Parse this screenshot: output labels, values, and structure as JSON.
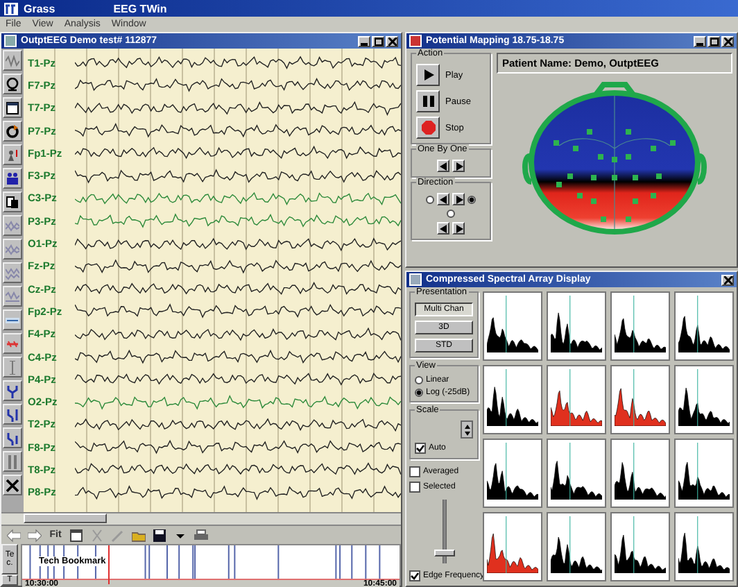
{
  "app_bar": {
    "title": "Grass",
    "subtitle": "EEG TWin"
  },
  "menu": [
    "File",
    "View",
    "Analysis",
    "Window"
  ],
  "eeg_window": {
    "title": "OutptEEG Demo test# 112877",
    "channels": [
      {
        "label": "T1-Pz",
        "highlighted": false
      },
      {
        "label": "F7-Pz",
        "highlighted": false
      },
      {
        "label": "T7-Pz",
        "highlighted": false
      },
      {
        "label": "P7-Pz",
        "highlighted": false
      },
      {
        "label": "Fp1-Pz",
        "highlighted": false
      },
      {
        "label": "F3-Pz",
        "highlighted": false
      },
      {
        "label": "C3-Pz",
        "highlighted": true
      },
      {
        "label": "P3-Pz",
        "highlighted": true
      },
      {
        "label": "O1-Pz",
        "highlighted": false
      },
      {
        "label": "Fz-Pz",
        "highlighted": false
      },
      {
        "label": "Cz-Pz",
        "highlighted": false
      },
      {
        "label": "Fp2-Pz",
        "highlighted": false
      },
      {
        "label": "F4-Pz",
        "highlighted": false
      },
      {
        "label": "C4-Pz",
        "highlighted": false
      },
      {
        "label": "P4-Pz",
        "highlighted": false
      },
      {
        "label": "O2-Pz",
        "highlighted": true
      },
      {
        "label": "T2-Pz",
        "highlighted": false
      },
      {
        "label": "F8-Pz",
        "highlighted": false
      },
      {
        "label": "T8-Pz",
        "highlighted": false
      },
      {
        "label": "P8-Pz",
        "highlighted": false
      }
    ],
    "toolbar": {
      "fit_label": "Fit"
    },
    "bookmarks": {
      "side_label": "Tec.",
      "side_button": "T",
      "label": "Tech Bookmark",
      "start_time": "10:30:00",
      "end_time": "10:45:00"
    }
  },
  "mapping_window": {
    "title": "Potential Mapping 18.75-18.75",
    "action_group": {
      "title": "Action",
      "play": "Play",
      "pause": "Pause",
      "stop": "Stop"
    },
    "one_by_one_group": {
      "title": "One By One"
    },
    "direction_group": {
      "title": "Direction",
      "options": [
        {
          "selected": false
        },
        {
          "selected": true
        },
        {
          "selected": false
        }
      ]
    },
    "patient_name": "Patient Name: Demo, OutptEEG"
  },
  "csa_window": {
    "title": "Compressed Spectral Array Display",
    "presentation": {
      "title": "Presentation",
      "buttons": [
        {
          "label": "Multi Chan",
          "selected": true
        },
        {
          "label": "3D",
          "selected": false
        },
        {
          "label": "STD",
          "selected": false
        }
      ]
    },
    "view": {
      "title": "View",
      "options": [
        {
          "label": "Linear",
          "selected": false
        },
        {
          "label": "Log (-25dB)",
          "selected": true
        }
      ]
    },
    "scale": {
      "title": "Scale",
      "auto_label": "Auto",
      "auto_checked": true
    },
    "averaged": {
      "label": "Averaged",
      "checked": false
    },
    "selected": {
      "label": "Selected",
      "checked": false
    },
    "slider": {
      "level": 0.1
    },
    "edge_frequency": {
      "label": "Edge Frequency",
      "checked": true
    },
    "plots": [
      {
        "highlighted": false
      },
      {
        "highlighted": false
      },
      {
        "highlighted": false
      },
      {
        "highlighted": false
      },
      {
        "highlighted": false
      },
      {
        "highlighted": true
      },
      {
        "highlighted": true
      },
      {
        "highlighted": false
      },
      {
        "highlighted": false
      },
      {
        "highlighted": false
      },
      {
        "highlighted": false
      },
      {
        "highlighted": false
      },
      {
        "highlighted": true
      },
      {
        "highlighted": false
      },
      {
        "highlighted": false
      },
      {
        "highlighted": false
      }
    ]
  }
}
